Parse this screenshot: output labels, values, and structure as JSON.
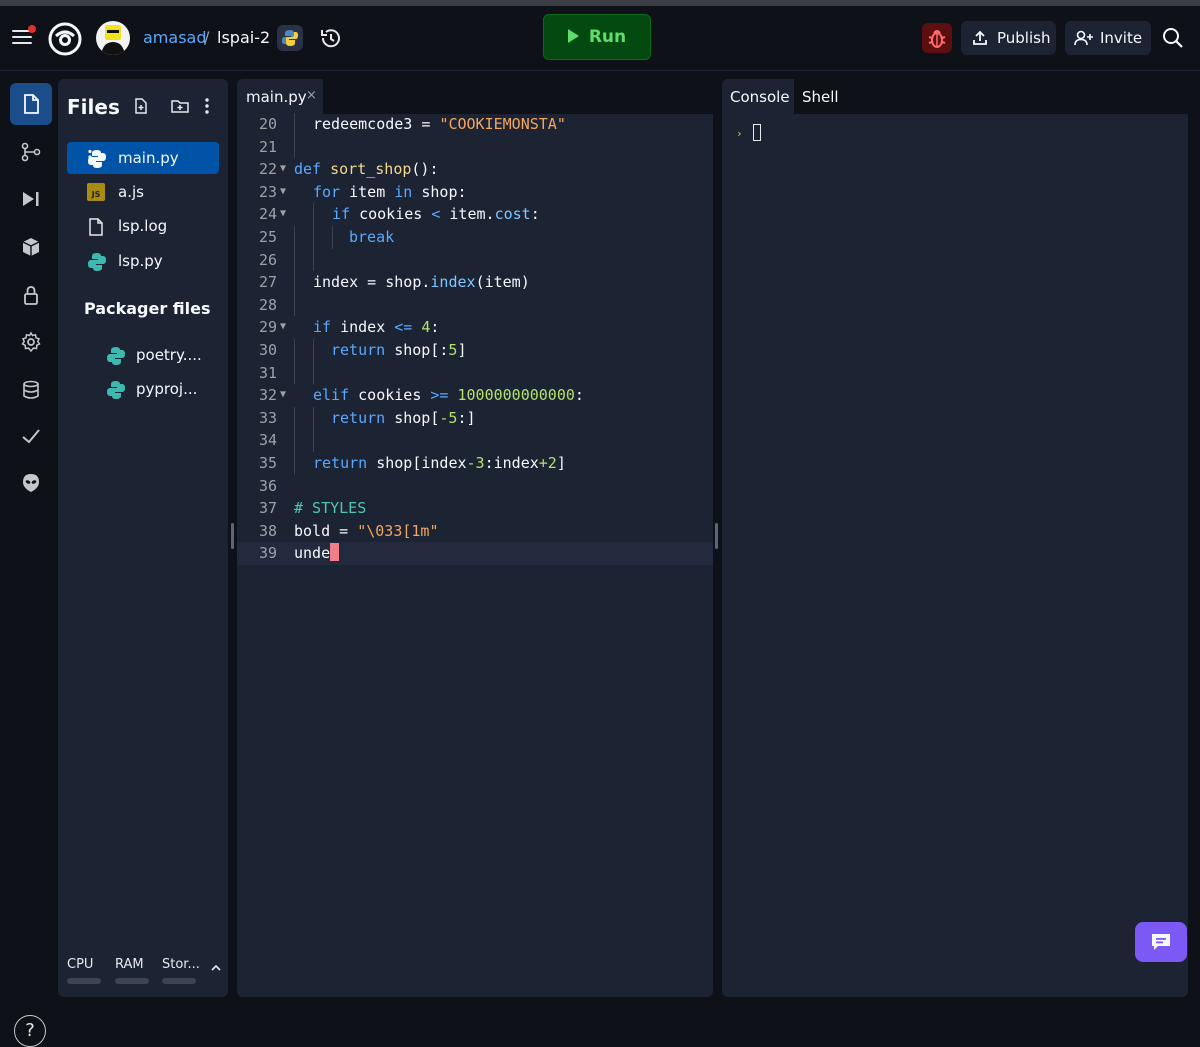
{
  "header": {
    "user": "amasad",
    "separator": "/",
    "repl_name": "lspai-2",
    "run_label": "Run",
    "publish_label": "Publish",
    "invite_label": "Invite"
  },
  "files_panel": {
    "title": "Files",
    "files": [
      {
        "name": "main.py",
        "type": "python",
        "active": true
      },
      {
        "name": "a.js",
        "type": "javascript",
        "active": false
      },
      {
        "name": "lsp.log",
        "type": "file",
        "active": false
      },
      {
        "name": "lsp.py",
        "type": "python",
        "active": false
      }
    ],
    "packager_title": "Packager files",
    "packager_files": [
      "poetry....",
      "pyproj..."
    ],
    "resources": [
      "CPU",
      "RAM",
      "Stor..."
    ]
  },
  "editor": {
    "tab": "main.py",
    "close": "×",
    "lines": [
      {
        "n": "20",
        "fold": false
      },
      {
        "n": "21",
        "fold": false
      },
      {
        "n": "22",
        "fold": true
      },
      {
        "n": "23",
        "fold": true
      },
      {
        "n": "24",
        "fold": true
      },
      {
        "n": "25",
        "fold": false
      },
      {
        "n": "26",
        "fold": false
      },
      {
        "n": "27",
        "fold": false
      },
      {
        "n": "28",
        "fold": false
      },
      {
        "n": "29",
        "fold": true
      },
      {
        "n": "30",
        "fold": false
      },
      {
        "n": "31",
        "fold": false
      },
      {
        "n": "32",
        "fold": true
      },
      {
        "n": "33",
        "fold": false
      },
      {
        "n": "34",
        "fold": false
      },
      {
        "n": "35",
        "fold": false
      },
      {
        "n": "36",
        "fold": false
      },
      {
        "n": "37",
        "fold": false
      },
      {
        "n": "38",
        "fold": false
      },
      {
        "n": "39",
        "fold": false
      }
    ],
    "code": {
      "l20": {
        "a": "redeemcode3",
        "b": " = ",
        "c": "\"COOKIEMONSTA\""
      },
      "l22": {
        "a": "def",
        "b": " ",
        "c": "sort_shop",
        "d": "():"
      },
      "l23": {
        "a": "for",
        "b": " item ",
        "c": "in",
        "d": " shop:"
      },
      "l24": {
        "a": "if",
        "b": " cookies ",
        "c": "<",
        "d": " item.",
        "e": "cost",
        "f": ":"
      },
      "l25": {
        "a": "break"
      },
      "l27": {
        "a": "index = shop.",
        "b": "index",
        "c": "(item)"
      },
      "l29": {
        "a": "if",
        "b": " index ",
        "c": "<=",
        "d": " ",
        "e": "4",
        "f": ":"
      },
      "l30": {
        "a": "return",
        "b": " shop[:",
        "c": "5",
        "d": "]"
      },
      "l32": {
        "a": "elif",
        "b": " cookies ",
        "c": ">=",
        "d": " ",
        "e": "1000000000000",
        "f": ":"
      },
      "l33": {
        "a": "return",
        "b": " shop[",
        "c": "-5",
        "d": ":]"
      },
      "l35": {
        "a": "return",
        "b": " shop[index",
        "c": "-3",
        "d": ":index",
        "e": "+2",
        "f": "]"
      },
      "l37": {
        "a": "# STYLES"
      },
      "l38": {
        "a": "bold = ",
        "b": "\"\\033[1m\""
      },
      "l39": {
        "a": "unde"
      }
    }
  },
  "console": {
    "tabs": [
      "Console",
      "Shell"
    ],
    "prompt": "›"
  },
  "help_label": "?",
  "colors": {
    "background": "#0e1117",
    "panel": "#1c2333",
    "accent_blue": "#0053a6",
    "run_green": "#044a10",
    "chat_purple": "#7c58f5",
    "danger_red": "#5c0f10"
  }
}
